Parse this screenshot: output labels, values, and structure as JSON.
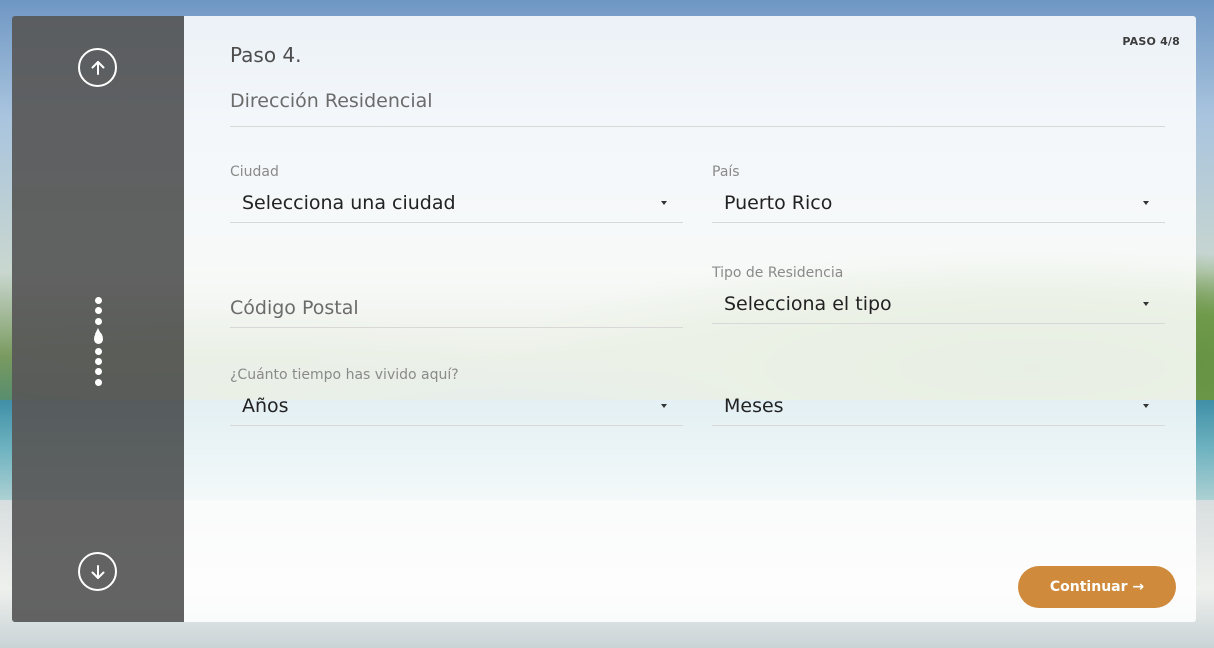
{
  "nav": {
    "up_icon": "arrow-up-circle-icon",
    "down_icon": "arrow-down-circle-icon",
    "total_steps": 8,
    "current_step": 4
  },
  "header": {
    "step_badge": "PASO 4/8",
    "step_title": "Paso 4.",
    "section_title": "Dirección Residencial"
  },
  "form": {
    "city": {
      "label": "Ciudad",
      "value": "Selecciona una ciudad"
    },
    "country": {
      "label": "País",
      "value": "Puerto Rico"
    },
    "zip": {
      "placeholder": "Código Postal"
    },
    "residence_type": {
      "label": "Tipo de Residencia",
      "value": "Selecciona el tipo"
    },
    "duration": {
      "label": "¿Cuánto tiempo has vivido aquí?",
      "years_value": "Años",
      "months_value": "Meses"
    }
  },
  "actions": {
    "continue_label": "Continuar →"
  },
  "colors": {
    "accent": "#cf8a3b",
    "sidebar": "#585858"
  }
}
